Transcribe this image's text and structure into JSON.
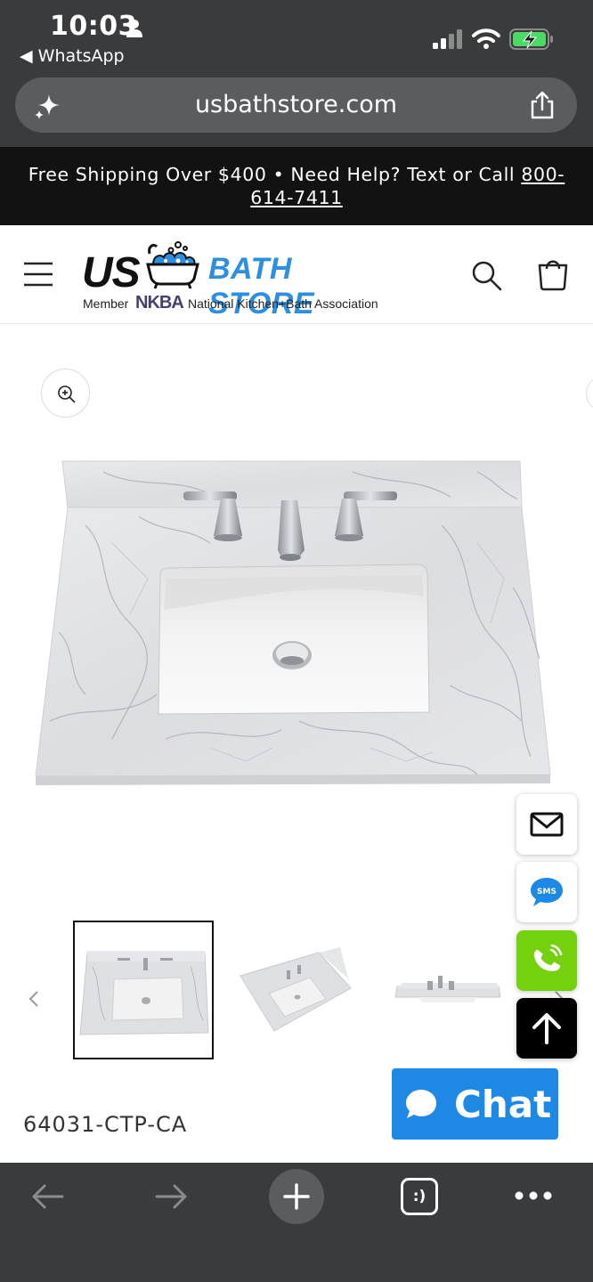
{
  "status_bar": {
    "time": "10:03",
    "back_app": "◀ WhatsApp",
    "icons": [
      "person-icon",
      "signal-icon",
      "wifi-icon",
      "battery-charging-icon"
    ]
  },
  "browser": {
    "url": "usbathstore.com",
    "tabs_label": ":)"
  },
  "announcement": {
    "text": "Free Shipping Over $400 • Need Help? Text or Call ",
    "phone_part1": "800-",
    "phone_part2": "614-7411"
  },
  "header": {
    "logo_us": "US",
    "logo_bath_store": "BATH STORE",
    "logo_member": "Member",
    "logo_nkba": "NKBA",
    "logo_association": "National Kitchen+Bath Association"
  },
  "product": {
    "sku": "64031-CTP-CA",
    "thumbnail_count": 3,
    "active_thumbnail": 1
  },
  "chat": {
    "label": "Chat"
  },
  "floating_contact": {
    "sms_label": "SMS"
  },
  "colors": {
    "brand_blue": "#2e8fe0",
    "chat_blue": "#1e88e5",
    "call_green": "#74d10d",
    "browser_chrome": "#3a3b3d",
    "announcement_bg": "#121212"
  }
}
